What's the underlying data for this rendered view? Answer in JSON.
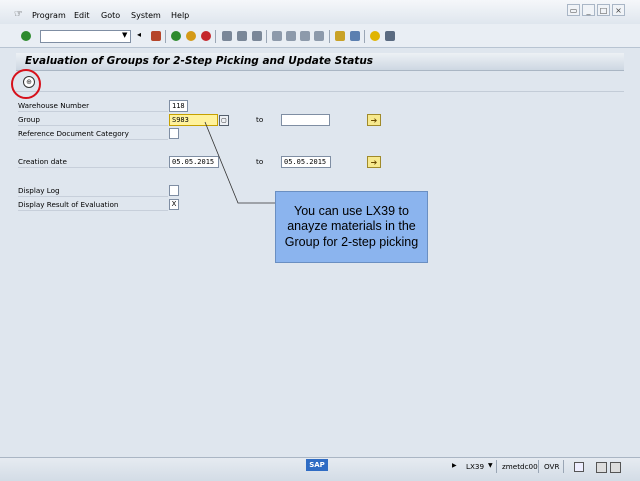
{
  "menu": {
    "items": [
      "Program",
      "Edit",
      "Goto",
      "System",
      "Help"
    ]
  },
  "toolbar": {
    "command_field_value": ""
  },
  "screen": {
    "title": "Evaluation of Groups for 2-Step Picking and Update Status"
  },
  "form": {
    "warehouse_number_label": "Warehouse Number",
    "warehouse_number_value": "118",
    "group_label": "Group",
    "group_value": "S983",
    "group_to_label": "to",
    "group_to_value": "",
    "ref_doc_category_label": "Reference Document Category",
    "ref_doc_category_value": "",
    "creation_date_label": "Creation date",
    "creation_date_from": "05.05.2015",
    "creation_date_to_label": "to",
    "creation_date_to": "05.05.2015",
    "display_log_label": "Display Log",
    "display_log_checked": "",
    "display_result_label": "Display Result of Evaluation",
    "display_result_checked": "X"
  },
  "callout": {
    "text": "You can use LX39 to anayze materials in the Group for 2-step picking"
  },
  "status": {
    "transaction": "LX39",
    "server": "zmetdc00",
    "mode": "OVR"
  },
  "colors": {
    "highlight_circle": "#d6111b",
    "callout_bg": "#8bb4ee"
  }
}
